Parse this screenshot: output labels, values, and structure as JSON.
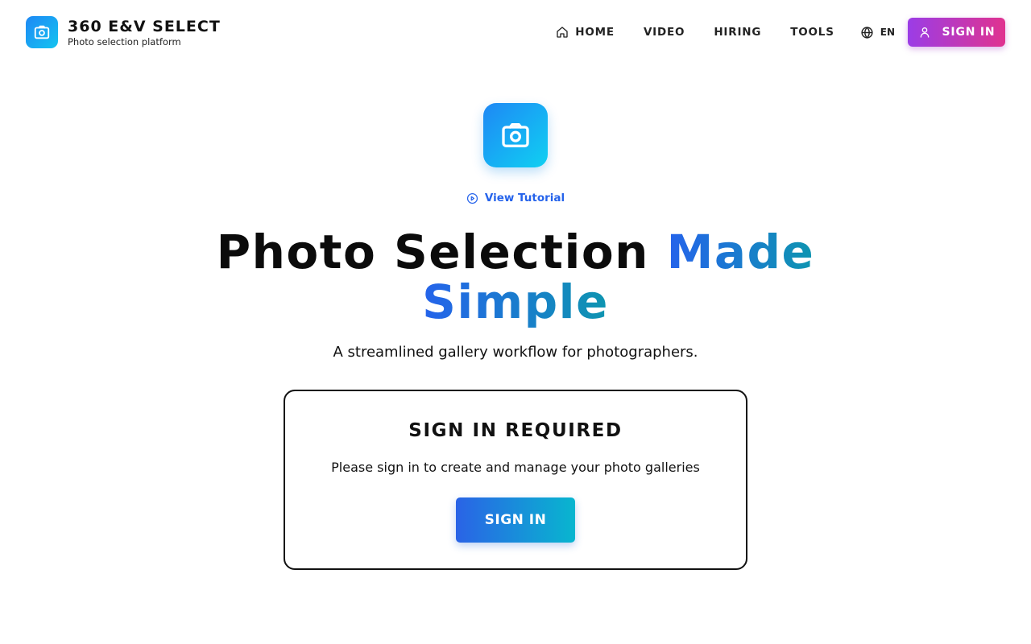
{
  "brand": {
    "title": "360 E&V SELECT",
    "subtitle": "Photo selection platform",
    "logo_icon": "camera-icon"
  },
  "nav": {
    "items": [
      {
        "label": "HOME",
        "icon": "home-icon"
      },
      {
        "label": "VIDEO"
      },
      {
        "label": "HIRING"
      },
      {
        "label": "TOOLS"
      }
    ],
    "language": {
      "label": "EN",
      "icon": "globe-icon"
    },
    "sign_in": {
      "label": "SIGN IN",
      "icon": "user-icon"
    }
  },
  "hero": {
    "icon": "camera-icon",
    "tutorial_label": "View Tutorial",
    "tutorial_icon": "play-circle-icon",
    "headline_plain": "Photo Selection",
    "headline_accent_1": "Made",
    "headline_accent_2": "Simple",
    "subtitle": "A streamlined gallery workflow for photographers."
  },
  "sign_in_card": {
    "title": "SIGN IN REQUIRED",
    "message": "Please sign in to create and manage your photo galleries",
    "button_label": "SIGN IN"
  },
  "colors": {
    "accent_blue": "#2563eb",
    "brand_gradient_start": "#1e88f5",
    "brand_gradient_end": "#14c4f0",
    "signin_gradient_start": "#9b3de6",
    "signin_gradient_end": "#e0338f"
  }
}
